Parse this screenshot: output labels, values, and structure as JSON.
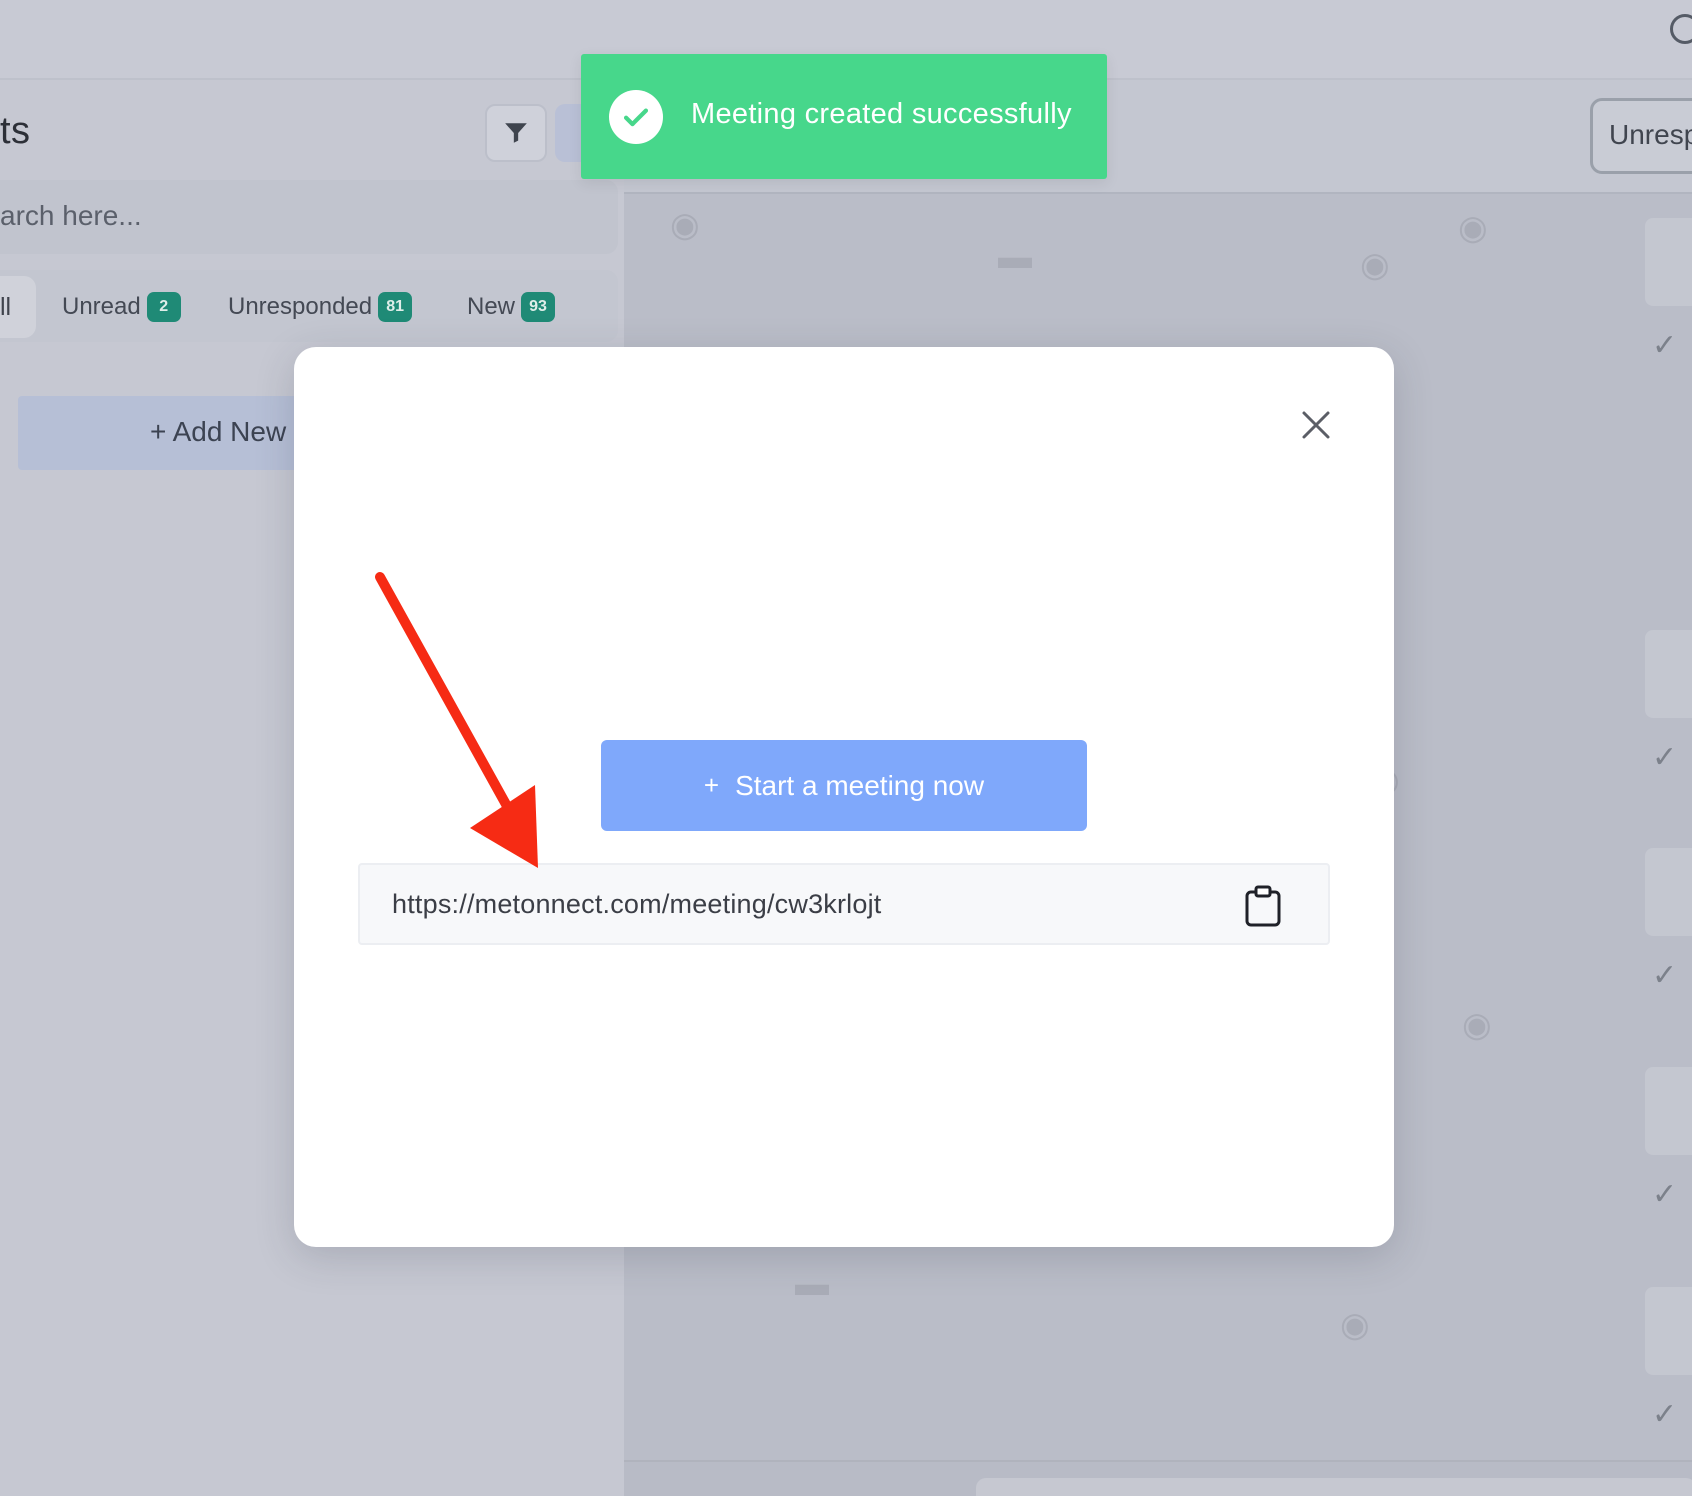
{
  "left_panel": {
    "title": "ts",
    "search_placeholder": "arch here...",
    "tabs": [
      {
        "label": "ll"
      },
      {
        "label": "Unread",
        "count": "2"
      },
      {
        "label": "Unresponded",
        "count": "81"
      },
      {
        "label": "New",
        "count": "93"
      }
    ],
    "add_new_label": "+ Add New"
  },
  "right_panel": {
    "unresponded_button_label": "Unresp"
  },
  "toast": {
    "message": "Meeting created successfully",
    "color": "#47d78b"
  },
  "modal": {
    "start_button_label": "Start a meeting now",
    "start_button_icon": "+",
    "meeting_link": "https://metonnect.com/meeting/cw3krlojt",
    "copy_icon": "clipboard-icon",
    "close_icon": "close-icon",
    "accent_color": "#7fa8fb"
  },
  "annotation": {
    "arrow_color": "#f62b14"
  }
}
